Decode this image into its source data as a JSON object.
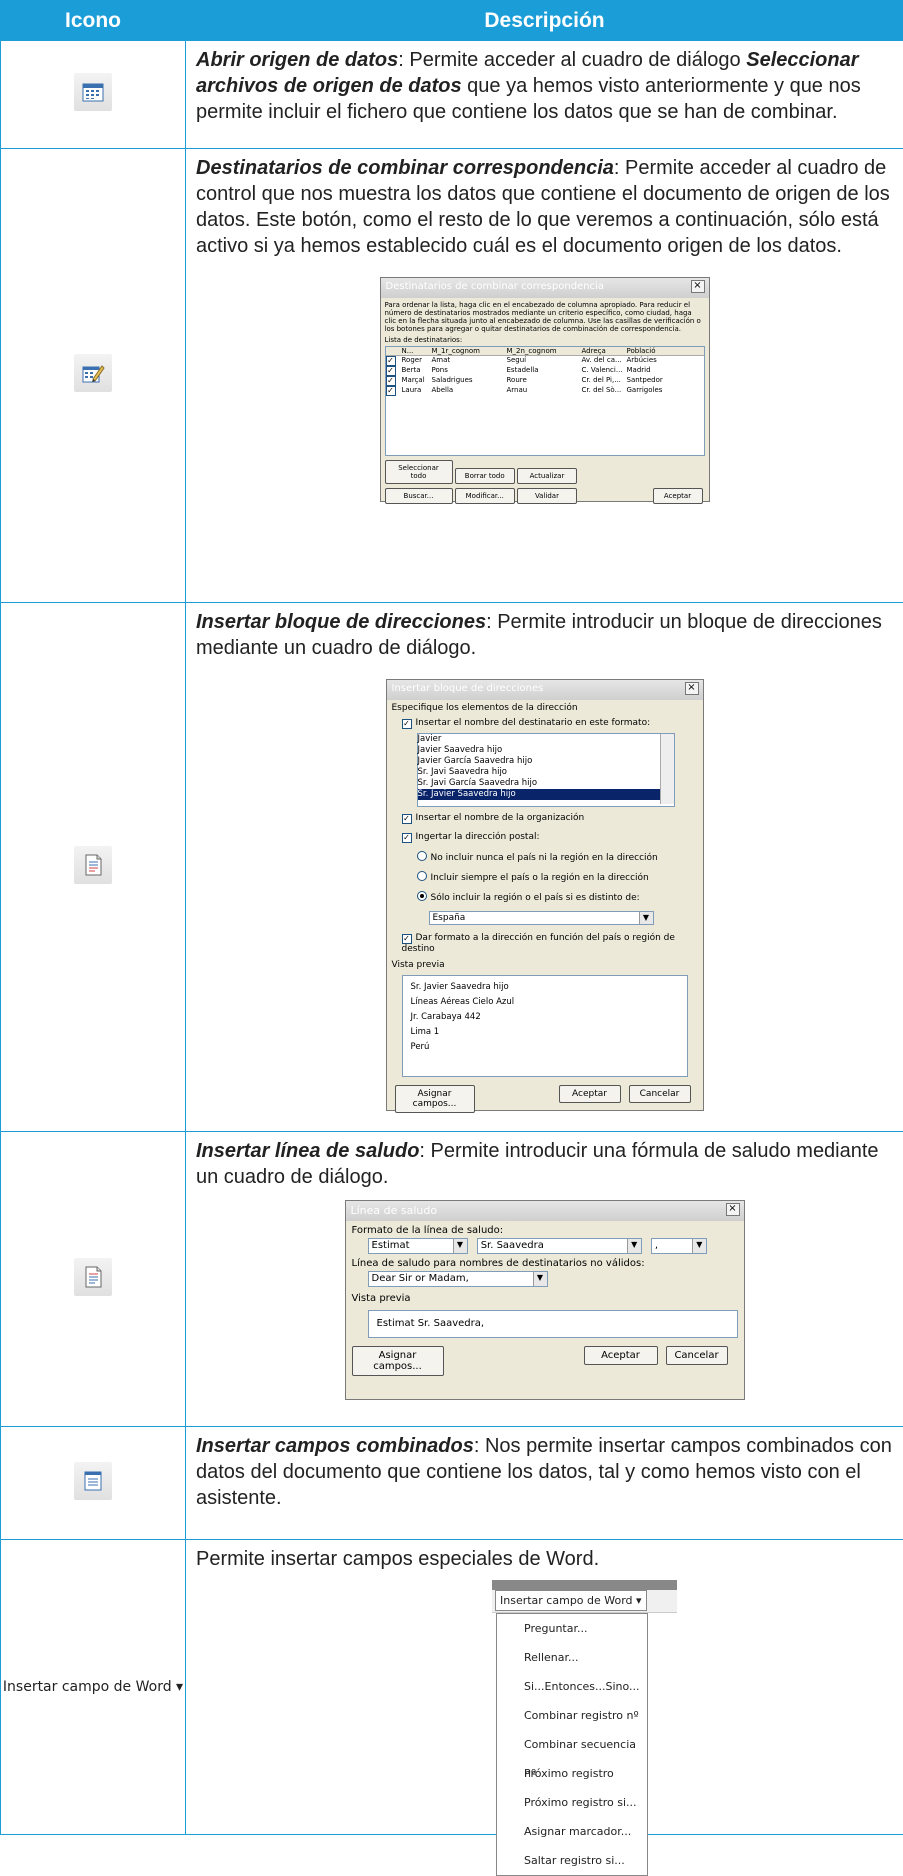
{
  "header": {
    "col1": "Icono",
    "col2": "Descripción"
  },
  "rows": [
    {
      "title": "Abrir origen de datos",
      "text1": ": Permite acceder al cuadro de diálogo ",
      "title2": "Seleccionar archivos de origen de datos",
      "text2": " que ya hemos visto anteriormente y que nos permite incluir el fichero que contiene los datos que se han de combinar.",
      "icon": "calendar-grid-icon"
    },
    {
      "title": "Destinatarios de combinar correspondencia",
      "text": ": Permite acceder al cuadro de control que nos muestra los datos que contiene el documento de origen de los datos. Este botón, como el resto de lo que veremos a continuación, sólo está activo si ya hemos establecido cuál es el documento origen de los datos.",
      "icon": "edit-recipients-icon"
    },
    {
      "title": "Insertar bloque de direcciones",
      "text": ": Permite introducir un bloque de direcciones mediante un cuadro de diálogo.",
      "icon": "address-block-icon"
    },
    {
      "title": "Insertar línea de saludo",
      "text": ": Permite introducir una fórmula de saludo mediante un cuadro de diálogo.",
      "icon": "greeting-line-icon"
    },
    {
      "title": "Insertar campos combinados",
      "text": ": Nos permite insertar campos combinados con datos del documento que contiene los datos, tal y como hemos visto con el asistente.",
      "icon": "merge-field-icon"
    },
    {
      "text": "Permite insertar campos especiales de Word.",
      "icon_label": "Insertar campo de Word ▾"
    }
  ],
  "dialog_recipients": {
    "title": "Destinatarios de combinar correspondencia",
    "intro": "Para ordenar la lista, haga clic en el encabezado de columna apropiado. Para reducir el número de destinatarios mostrados mediante un criterio específico, como ciudad, haga clic en la flecha situada junto al encabezado de columna. Use las casillas de verificación o los botones para agregar o quitar destinatarios de combinación de correspondencia.",
    "list_label": "Lista de destinatarios:",
    "columns": [
      "N...",
      "M_1r_cognom",
      "M_2n_cognom",
      "Adreça",
      "Població"
    ],
    "rows": [
      [
        "Roger",
        "Amat",
        "Seguí",
        "Av. del ca...",
        "Arbúcies"
      ],
      [
        "Berta",
        "Pons",
        "Estadella",
        "C. Valenci...",
        "Madrid"
      ],
      [
        "Marçal",
        "Saladrigues",
        "Roure",
        "Cr. del Pi,...",
        "Santpedor"
      ],
      [
        "Laura",
        "Abella",
        "Arnau",
        "Cr. del Sò...",
        "Garrigoles"
      ]
    ],
    "buttons": {
      "select_all": "Seleccionar todo",
      "clear_all": "Borrar todo",
      "refresh": "Actualizar",
      "find": "Buscar...",
      "edit": "Modificar...",
      "validate": "Validar",
      "accept": "Aceptar"
    }
  },
  "dialog_address": {
    "title": "Insertar bloque de direcciones",
    "group1": "Especifique los elementos de la dirección",
    "chk_name": "Insertar el nombre del destinatario en este formato:",
    "formats": [
      "Javier",
      "Javier Saavedra hijo",
      "Javier García Saavedra hijo",
      "Sr. Javi Saavedra hijo",
      "Sr. Javi García Saavedra hijo",
      "Sr. Javier Saavedra hijo"
    ],
    "chk_org": "Insertar el nombre de la organización",
    "chk_postal": "Ingertar la dirección postal:",
    "radio1": "No incluir nunca el país ni la región en la dirección",
    "radio2": "Incluir siempre el país o la región en la dirección",
    "radio3": "Sólo incluir la región o el país si es distinto de:",
    "country": "España",
    "chk_format": "Dar formato a la dirección en función del país o región de destino",
    "preview_label": "Vista previa",
    "preview": [
      "Sr. Javier Saavedra hijo",
      "Líneas Aéreas Cielo Azul",
      "Jr. Carabaya 442",
      "Lima 1",
      "Perú"
    ],
    "buttons": {
      "assign": "Asignar campos...",
      "accept": "Aceptar",
      "cancel": "Cancelar"
    }
  },
  "dialog_greeting": {
    "title": "Línea de saludo",
    "format_label": "Formato de la línea de saludo:",
    "salutation": "Estimat",
    "name": "Sr. Saavedra",
    "punct": ",",
    "invalid_label": "Línea de saludo para nombres de destinatarios no válidos:",
    "invalid_value": "Dear Sir or Madam,",
    "preview_label": "Vista previa",
    "preview": "Estimat Sr. Saavedra,",
    "buttons": {
      "assign": "Asignar campos...",
      "accept": "Aceptar",
      "cancel": "Cancelar"
    }
  },
  "word_menu": {
    "button": "Insertar campo de Word ▾",
    "items": [
      "Preguntar...",
      "Rellenar...",
      "Si...Entonces...Sino...",
      "Combinar registro nº",
      "Combinar secuencia nº",
      "Próximo registro",
      "Próximo registro si...",
      "Asignar marcador...",
      "Saltar registro si..."
    ]
  }
}
